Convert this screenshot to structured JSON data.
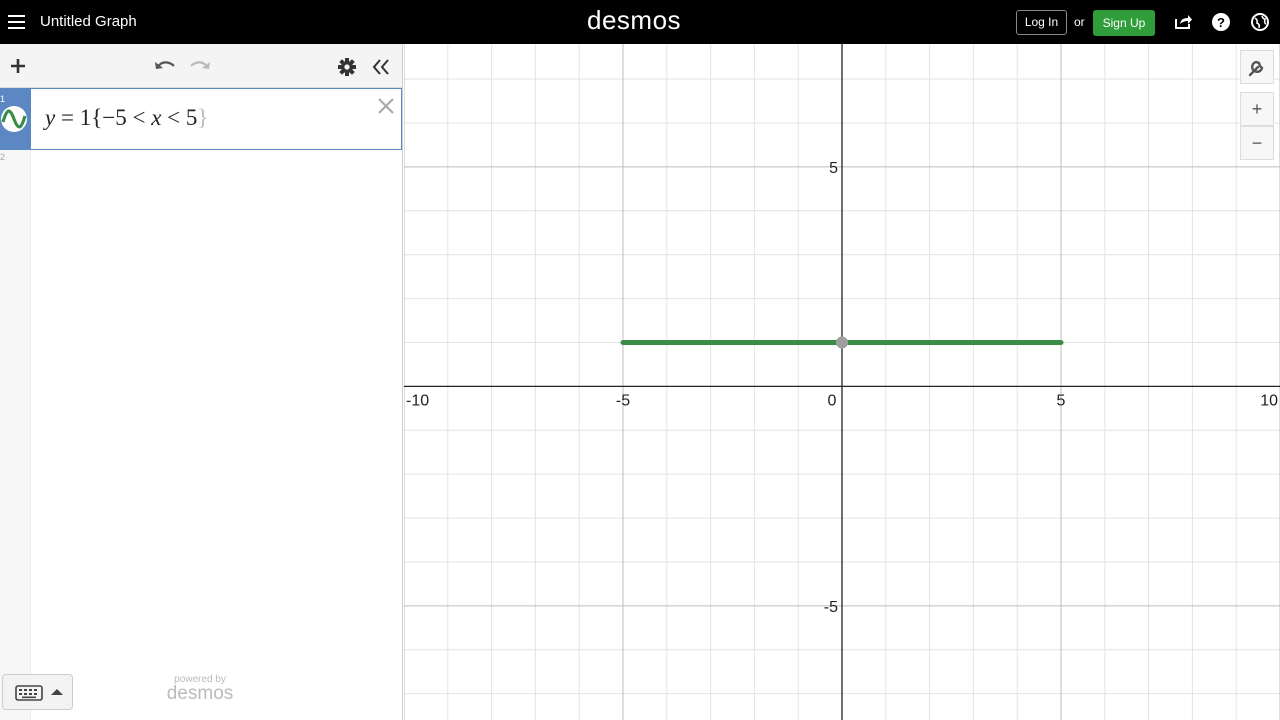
{
  "header": {
    "title": "Untitled Graph",
    "brand": "desmos",
    "login_label": "Log In",
    "or_label": "or",
    "signup_label": "Sign Up",
    "icons": [
      "menu-icon",
      "share-icon",
      "help-icon",
      "globe-icon"
    ],
    "signup_color": "#2f9e3a"
  },
  "expression_panel": {
    "toolbar_icons": [
      "plus-icon",
      "undo-icon",
      "redo-icon",
      "gear-icon",
      "double-chevron-left-icon"
    ],
    "expressions": [
      {
        "index": "1",
        "latex_display": {
          "y": "y",
          "eq": " = 1",
          "brace_open": "{",
          "condition_left": "−5 < ",
          "x": "x",
          "condition_right": " < 5",
          "brace_close": "}"
        },
        "color": "#388c46"
      }
    ],
    "next_index": "2",
    "powered_by_small": "powered by",
    "powered_by_brand": "desmos"
  },
  "graph": {
    "x_ticks": [
      "-10",
      "-5",
      "0",
      "5",
      "10"
    ],
    "y_ticks": [
      "5",
      "-5"
    ],
    "curve_color": "#388c46",
    "controls": [
      "wrench-icon",
      "zoom-in-icon",
      "zoom-out-icon"
    ],
    "zoom_in_label": "+",
    "zoom_out_label": "−"
  },
  "chart_data": {
    "type": "line",
    "series": [
      {
        "x": [
          -5,
          5
        ],
        "y": [
          1,
          1
        ]
      }
    ],
    "xlim": [
      -10,
      10
    ],
    "ylim": [
      -7.6,
      7.8
    ],
    "grid": true,
    "title": "",
    "xlabel": "",
    "ylabel": "",
    "x_ticks": [
      -10,
      -5,
      0,
      5,
      10
    ],
    "y_ticks": [
      -5,
      5
    ]
  }
}
